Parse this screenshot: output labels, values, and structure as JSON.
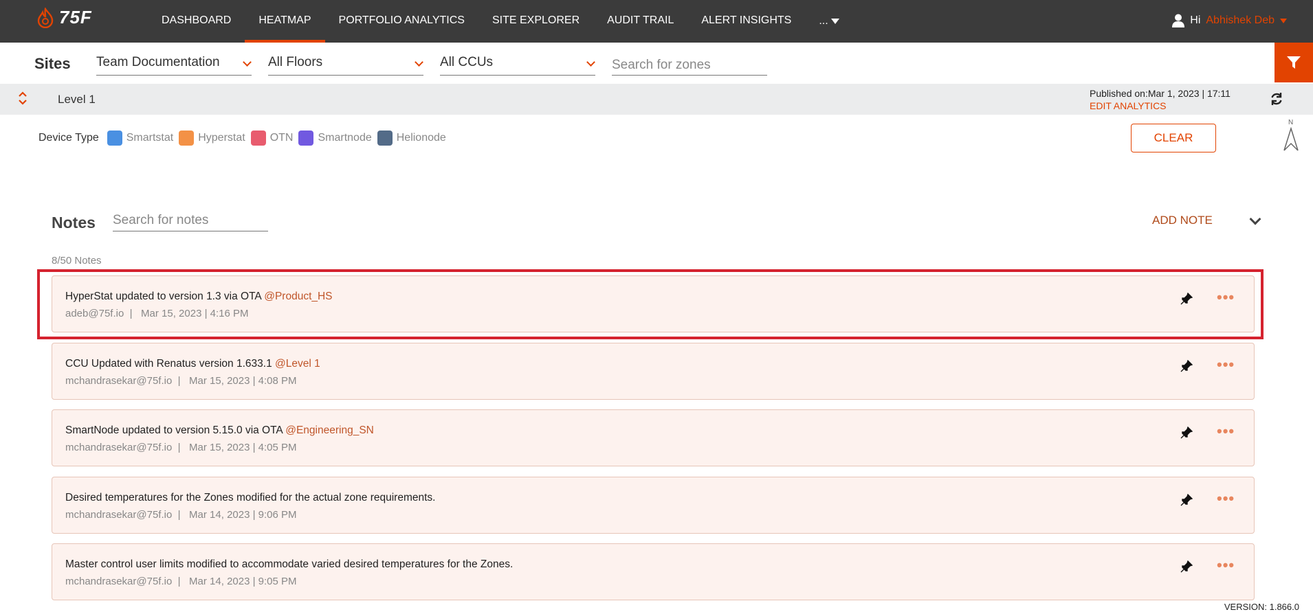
{
  "brand": {
    "name": "75F",
    "accent": "#e24301"
  },
  "nav": {
    "items": [
      {
        "label": "DASHBOARD"
      },
      {
        "label": "HEATMAP",
        "active": true
      },
      {
        "label": "PORTFOLIO ANALYTICS"
      },
      {
        "label": "SITE EXPLORER"
      },
      {
        "label": "AUDIT TRAIL"
      },
      {
        "label": "ALERT INSIGHTS"
      }
    ],
    "more_label": "..."
  },
  "user": {
    "greeting": "Hi",
    "name": "Abhishek Deb"
  },
  "filters": {
    "title": "Sites",
    "site": "Team Documentation",
    "floors": "All Floors",
    "ccus": "All CCUs",
    "zone_search_placeholder": "Search for zones"
  },
  "level": {
    "name": "Level 1",
    "published": "Published on:Mar 1, 2023 | 17:11",
    "edit_label": "EDIT ANALYTICS"
  },
  "device_types": {
    "label": "Device Type",
    "items": [
      {
        "name": "Smartstat",
        "color": "#4a90e2"
      },
      {
        "name": "Hyperstat",
        "color": "#f39146"
      },
      {
        "name": "OTN",
        "color": "#e85c6e"
      },
      {
        "name": "Smartnode",
        "color": "#7159e0"
      },
      {
        "name": "Helionode",
        "color": "#536b88"
      }
    ],
    "clear_label": "CLEAR",
    "compass_label": "N"
  },
  "notes": {
    "title": "Notes",
    "search_placeholder": "Search for notes",
    "add_label": "ADD NOTE",
    "count": "8/50 Notes",
    "items": [
      {
        "text": "HyperStat updated to version 1.3 via OTA",
        "tag": "@Product_HS",
        "author": "adeb@75f.io",
        "date": "Mar 15, 2023 | 4:16 PM"
      },
      {
        "text": "CCU Updated with Renatus version 1.633.1",
        "tag": "@Level 1",
        "author": "mchandrasekar@75f.io",
        "date": "Mar 15, 2023 | 4:08 PM"
      },
      {
        "text": "SmartNode updated to version 5.15.0  via OTA",
        "tag": "@Engineering_SN",
        "author": "mchandrasekar@75f.io",
        "date": "Mar 15, 2023 | 4:05 PM"
      },
      {
        "text": "Desired temperatures for the Zones modified for the actual zone requirements.",
        "tag": "",
        "author": "mchandrasekar@75f.io",
        "date": "Mar 14, 2023 | 9:06 PM"
      },
      {
        "text": "Master control user limits modified to accommodate varied desired temperatures for the Zones.",
        "tag": "",
        "author": "mchandrasekar@75f.io",
        "date": "Mar 14, 2023 | 9:05 PM"
      }
    ]
  },
  "version": "VERSION: 1.866.0"
}
